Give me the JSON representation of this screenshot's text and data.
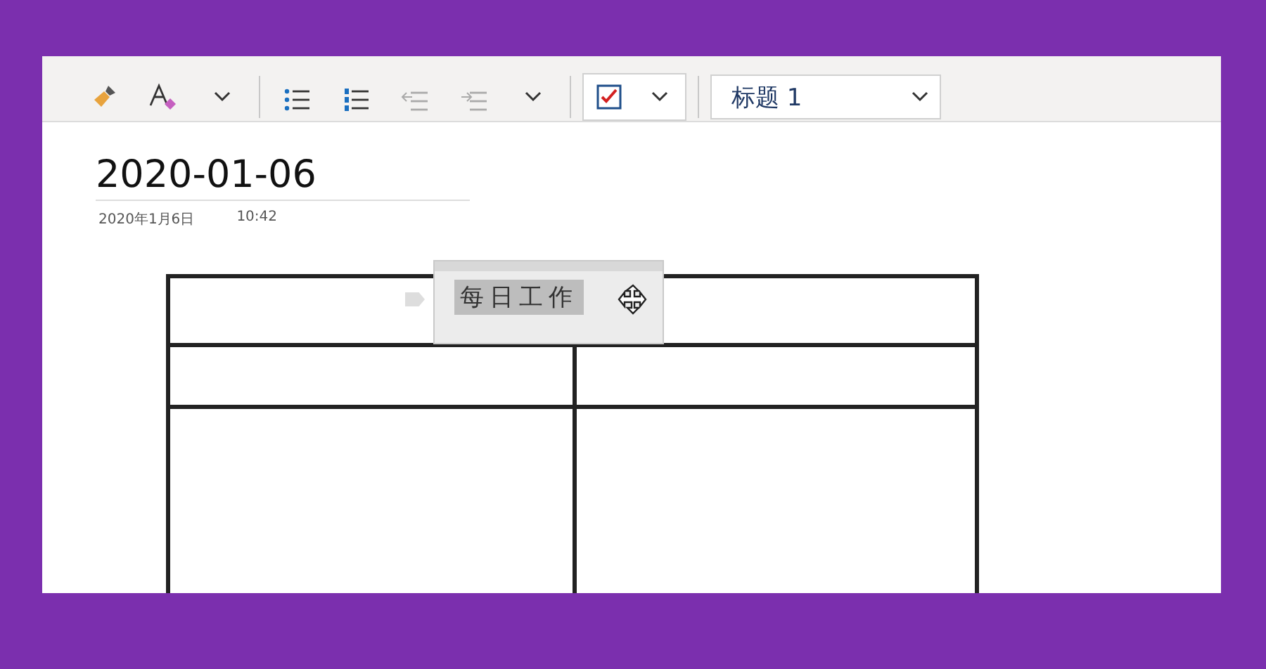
{
  "toolbar": {
    "groups": [
      {
        "items": [
          {
            "kind": "painter"
          },
          {
            "kind": "clear-format"
          },
          {
            "kind": "chevron"
          }
        ]
      },
      {
        "items": [
          {
            "kind": "bullets"
          },
          {
            "kind": "numbering"
          },
          {
            "kind": "outdent"
          },
          {
            "kind": "indent"
          },
          {
            "kind": "chevron"
          }
        ]
      }
    ],
    "tag": {
      "checked": true
    },
    "style_select": {
      "value": "标题 1"
    }
  },
  "page": {
    "title": "2020-01-06",
    "date": "2020年1月6日",
    "time": "10:42"
  },
  "table": {
    "header": {
      "text": "每日工作",
      "selected": true
    },
    "rows": [
      {
        "cells": [
          "",
          ""
        ]
      },
      {
        "cells": [
          "",
          ""
        ]
      }
    ]
  }
}
